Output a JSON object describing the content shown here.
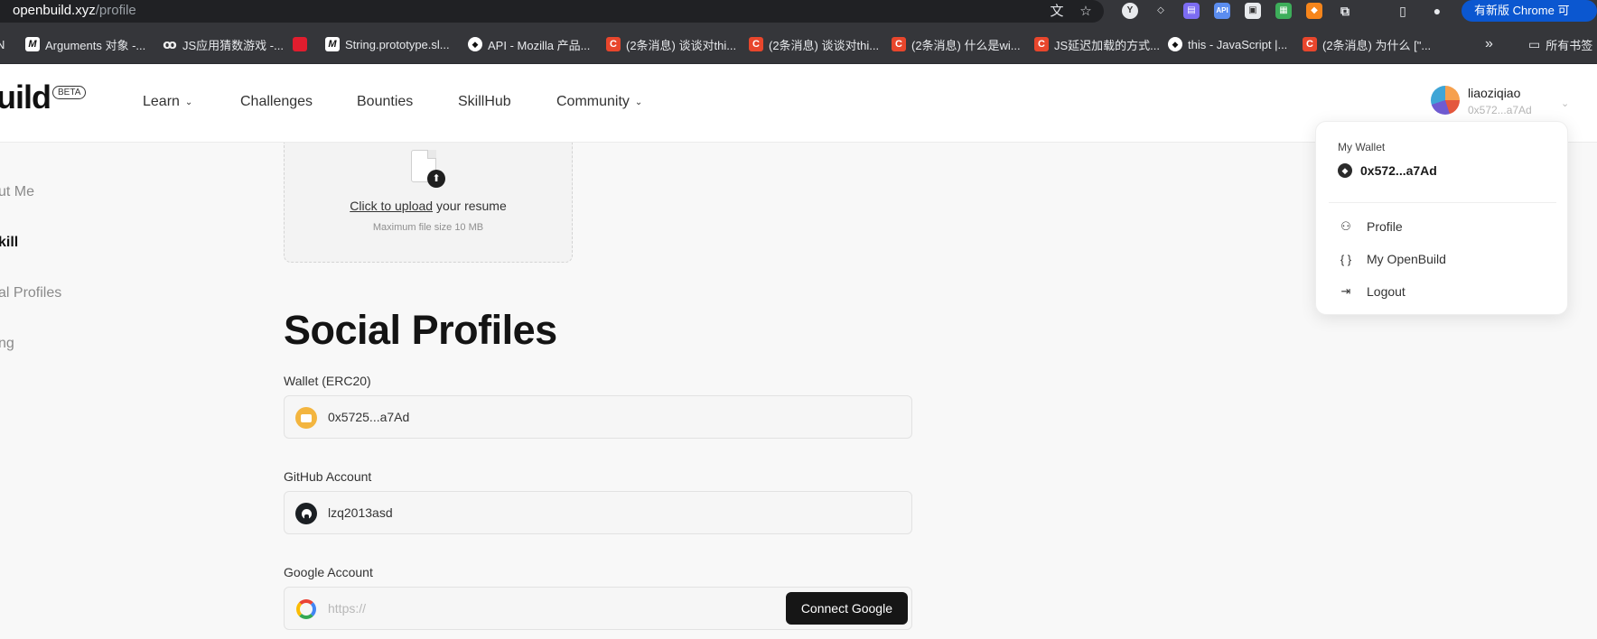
{
  "browser": {
    "url_host": "openbuild.xyz",
    "url_path": "/profile",
    "update_label": "有新版 Chrome 可用",
    "bookmarks": [
      {
        "icon": "m-icon",
        "label": "Arguments 对象 -..."
      },
      {
        "icon": "gh-icon",
        "label": "JS应用猜数游戏 -..."
      },
      {
        "icon": "red-icon",
        "label": ""
      },
      {
        "icon": "m-icon",
        "label": "String.prototype.sl..."
      },
      {
        "icon": "mdn-icon",
        "label": "API - Mozilla 产品..."
      },
      {
        "icon": "c-icon",
        "label": "(2条消息) 谈谈对thi..."
      },
      {
        "icon": "c-icon",
        "label": "(2条消息) 谈谈对thi..."
      },
      {
        "icon": "c-icon",
        "label": "(2条消息) 什么是wi..."
      },
      {
        "icon": "c-icon",
        "label": "JS延迟加载的方式..."
      },
      {
        "icon": "mdn-icon",
        "label": "this - JavaScript |..."
      },
      {
        "icon": "c-icon",
        "label": "(2条消息) 为什么 [\"..."
      }
    ],
    "bookmarks_more": "»",
    "all_bookmarks": "所有书签"
  },
  "header": {
    "logo": "uild",
    "beta": "BETA",
    "nav": [
      {
        "label": "Learn",
        "has_menu": true
      },
      {
        "label": "Challenges",
        "has_menu": false
      },
      {
        "label": "Bounties",
        "has_menu": false
      },
      {
        "label": "SkillHub",
        "has_menu": false
      },
      {
        "label": "Community",
        "has_menu": true
      }
    ],
    "user": {
      "name": "liaoziqiao",
      "address": "0x572...a7Ad"
    }
  },
  "sidebar": {
    "items": [
      {
        "label": "ut Me",
        "active": false
      },
      {
        "label": "kill",
        "active": true
      },
      {
        "label": "al Profiles",
        "active": false
      },
      {
        "label": "ng",
        "active": false
      }
    ]
  },
  "upload": {
    "link": "Click to upload",
    "rest": " your resume",
    "max": "Maximum file size 10 MB"
  },
  "social": {
    "title": "Social Profiles",
    "wallet": {
      "label": "Wallet (ERC20)",
      "value": "0x5725...a7Ad"
    },
    "github": {
      "label": "GitHub Account",
      "value": "lzq2013asd"
    },
    "google": {
      "label": "Google Account",
      "placeholder": "https://",
      "button": "Connect Google"
    }
  },
  "dropdown": {
    "caption": "My Wallet",
    "wallet": "0x572...a7Ad",
    "items": [
      {
        "icon": "user-icon",
        "label": "Profile"
      },
      {
        "icon": "braces-icon",
        "label": "My OpenBuild"
      },
      {
        "icon": "logout-icon",
        "label": "Logout"
      }
    ]
  }
}
